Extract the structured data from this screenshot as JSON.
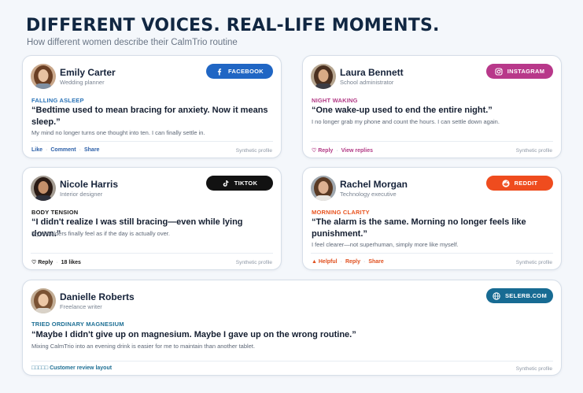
{
  "header": {
    "title": "DIFFERENT VOICES. REAL-LIFE MOMENTS.",
    "subtitle": "How different women describe their CalmTrio routine"
  },
  "cards": [
    {
      "name": "Emily Carter",
      "role": "Wedding planner",
      "platform": "FACEBOOK",
      "platform_icon": "facebook-icon",
      "badge_color": "#2066c4",
      "tag": "FALLING ASLEEP",
      "tag_color": "#2b74b8",
      "quote": "“Bedtime used to mean bracing for anxiety. Now it means sleep.”",
      "detail": "My mind no longer turns one thought into ten. I can finally settle in.",
      "actions": [
        "Like",
        "Comment",
        "Share"
      ],
      "action_color": "#2b5fa8",
      "note": "Synthetic profile"
    },
    {
      "name": "Laura Bennett",
      "role": "School administrator",
      "platform": "INSTAGRAM",
      "platform_icon": "instagram-icon",
      "badge_color": "#b8388a",
      "tag": "NIGHT WAKING",
      "tag_color": "#b23a85",
      "quote": "“One wake-up used to end the entire night.”",
      "detail": "I no longer grab my phone and count the hours. I can settle down again.",
      "actions": [
        "♡ Reply",
        "View replies"
      ],
      "action_color": "#b23a85",
      "note": "Synthetic profile"
    },
    {
      "name": "Nicole Harris",
      "role": "Interior designer",
      "platform": "TIKTOK",
      "platform_icon": "tiktok-icon",
      "badge_color": "#121212",
      "tag": "BODY TENSION",
      "tag_color": "#1a1a1a",
      "quote": "“I didn't realize I was still bracing—even while lying down.”",
      "detail": "My shoulders finally feel as if the day is actually over.",
      "actions": [
        "♡ Reply",
        "18 likes"
      ],
      "action_color": "#1a1a1a",
      "note": "Synthetic profile"
    },
    {
      "name": "Rachel Morgan",
      "role": "Technology executive",
      "platform": "REDDIT",
      "platform_icon": "reddit-icon",
      "badge_color": "#ef4c1e",
      "tag": "MORNING CLARITY",
      "tag_color": "#e8531f",
      "quote": "“The alarm is the same. Morning no longer feels like punishment.”",
      "detail": "I feel clearer—not superhuman, simply more like myself.",
      "actions": [
        "▲ Helpful",
        "Reply",
        "Share"
      ],
      "action_color": "#e0501f",
      "note": "Synthetic profile"
    },
    {
      "name": "Danielle Roberts",
      "role": "Freelance writer",
      "platform": "SELERB.COM",
      "platform_icon": "globe-icon",
      "badge_color": "#176b93",
      "tag": "TRIED ORDINARY MAGNESIUM",
      "tag_color": "#1d6f94",
      "quote": "“Maybe I didn't give up on magnesium. Maybe I gave up on the wrong routine.”",
      "detail": "Mixing CalmTrio into an evening drink is easier for me to maintain than another tablet.",
      "actions": [
        "□□□□□ Customer review layout"
      ],
      "action_color": "#1d6f94",
      "note": "Synthetic profile"
    }
  ]
}
